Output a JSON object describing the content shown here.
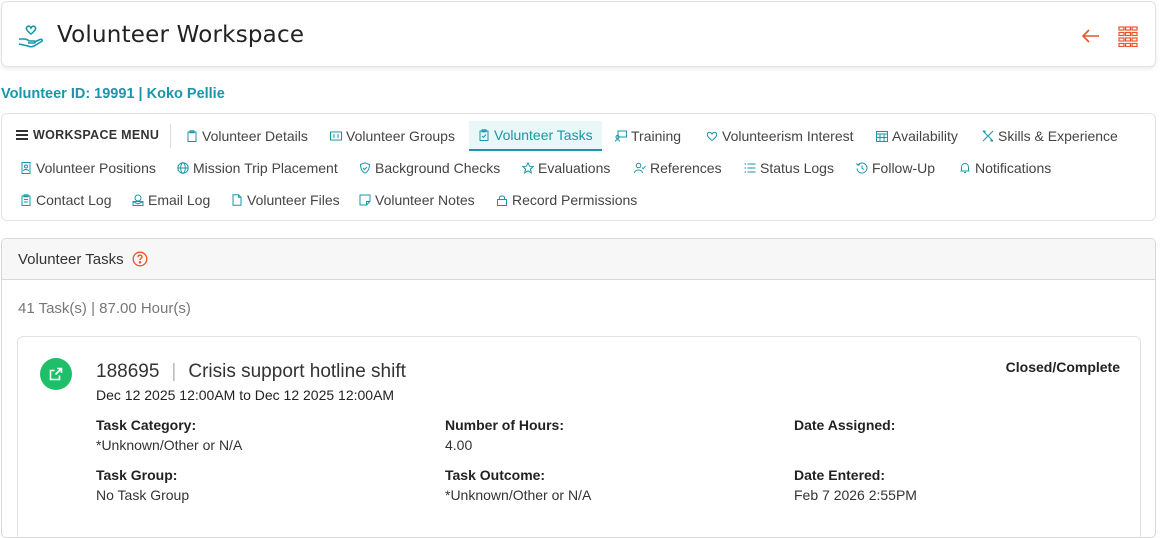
{
  "header": {
    "title": "Volunteer Workspace",
    "logo_icon": "hand-heart-icon",
    "back_icon": "arrow-left-icon",
    "apps_icon": "grid-menu-icon",
    "accent_color": "#e8552b"
  },
  "volunteer": {
    "id_line": "Volunteer ID: 19991 | Koko Pellie"
  },
  "menu": {
    "label": "WORKSPACE MENU",
    "items": [
      {
        "label": "Volunteer Details",
        "icon": "clipboard-icon"
      },
      {
        "label": "Volunteer Groups",
        "icon": "id-card-icon"
      },
      {
        "label": "Volunteer Tasks",
        "icon": "clipboard-check-icon",
        "active": true
      },
      {
        "label": "Training",
        "icon": "presentation-icon"
      },
      {
        "label": "Volunteerism Interest",
        "icon": "heart-icon"
      },
      {
        "label": "Availability",
        "icon": "calendar-icon"
      },
      {
        "label": "Skills & Experience",
        "icon": "tools-icon"
      },
      {
        "label": "Volunteer Positions",
        "icon": "badge-icon"
      },
      {
        "label": "Mission Trip Placement",
        "icon": "globe-icon"
      },
      {
        "label": "Background Checks",
        "icon": "shield-check-icon"
      },
      {
        "label": "Evaluations",
        "icon": "star-icon"
      },
      {
        "label": "References",
        "icon": "user-check-icon"
      },
      {
        "label": "Status Logs",
        "icon": "list-icon"
      },
      {
        "label": "Follow-Up",
        "icon": "history-icon"
      },
      {
        "label": "Notifications",
        "icon": "bell-icon"
      },
      {
        "label": "Contact Log",
        "icon": "clipboard-list-icon"
      },
      {
        "label": "Email Log",
        "icon": "email-icon"
      },
      {
        "label": "Volunteer Files",
        "icon": "file-icon"
      },
      {
        "label": "Volunteer Notes",
        "icon": "note-icon"
      },
      {
        "label": "Record Permissions",
        "icon": "lock-icon"
      }
    ]
  },
  "panel": {
    "title": "Volunteer Tasks",
    "summary": "41 Task(s) | 87.00 Hour(s)"
  },
  "task": {
    "id": "188695",
    "separator": "|",
    "name": "Crisis support hotline shift",
    "dates": "Dec 12 2025 12:00AM to Dec 12 2025 12:00AM",
    "status": "Closed/Complete",
    "fields": {
      "category_label": "Task Category:",
      "category_value": "*Unknown/Other or N/A",
      "hours_label": "Number of Hours:",
      "hours_value": "4.00",
      "assigned_label": "Date Assigned:",
      "assigned_value": "",
      "group_label": "Task Group:",
      "group_value": "No Task Group",
      "outcome_label": "Task Outcome:",
      "outcome_value": "*Unknown/Other or N/A",
      "entered_label": "Date Entered:",
      "entered_value": "Feb 7 2026 2:55PM"
    }
  }
}
